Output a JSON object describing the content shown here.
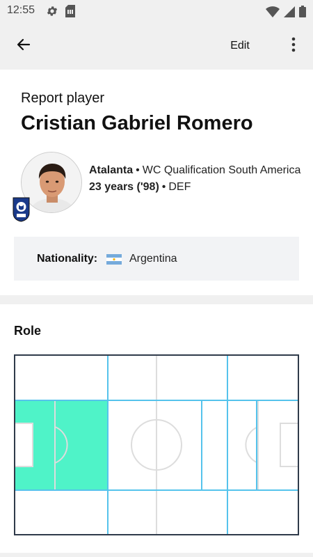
{
  "status_bar": {
    "time": "12:55"
  },
  "app_bar": {
    "edit_label": "Edit"
  },
  "report": {
    "label": "Report player",
    "player_name": "Cristian Gabriel Romero",
    "club": "Atalanta",
    "competition": "WC Qualification South America",
    "age": "23 years ('98)",
    "position": "DEF"
  },
  "nationality": {
    "label": "Nationality:",
    "value": "Argentina"
  },
  "role": {
    "title": "Role",
    "highlighted_zone": "left-central-defense"
  },
  "colors": {
    "accent_zone": "#4ff3c8",
    "grid_line": "#55c3ec",
    "pitch_line": "#dddddd",
    "pitch_border": "#2f3a4a"
  },
  "icons": [
    "gear-icon",
    "sim-icon",
    "wifi-icon",
    "signal-icon",
    "battery-icon",
    "back-arrow-icon",
    "more-vert-icon"
  ]
}
